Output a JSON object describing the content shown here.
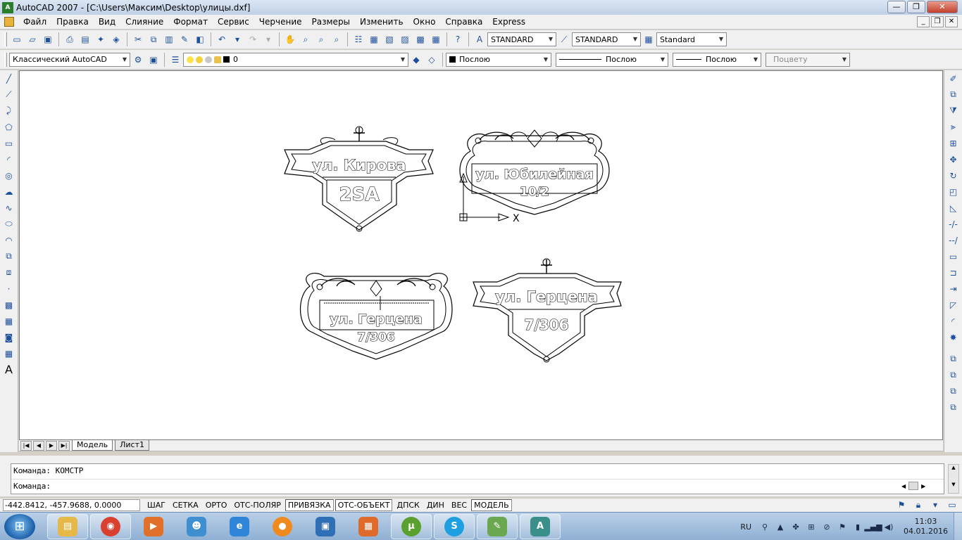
{
  "window": {
    "title": "AutoCAD 2007 - [C:\\Users\\Максим\\Desktop\\улицы.dxf]",
    "app_icon_label": "A",
    "buttons": [
      "—",
      "❐",
      "✕"
    ]
  },
  "menu": {
    "items": [
      "Файл",
      "Правка",
      "Вид",
      "Слияние",
      "Формат",
      "Сервис",
      "Черчение",
      "Размеры",
      "Изменить",
      "Окно",
      "Справка",
      "Express"
    ],
    "mdi_buttons": [
      "_",
      "❐",
      "✕"
    ]
  },
  "toolbar1": {
    "text_style": "STANDARD",
    "dim_style": "STANDARD",
    "table_style": "Standard"
  },
  "toolbar2": {
    "workspace": "Классический AutoCAD",
    "layer": "0",
    "color": "Послою",
    "linetype": "Послою",
    "lineweight": "Послою",
    "plot_style": "Поцвету"
  },
  "signs": [
    {
      "street": "ул. Кирова",
      "number": "2SA"
    },
    {
      "street": "ул. Юбилейная",
      "number": "10/2"
    },
    {
      "street": "ул. Герцена",
      "number": "7/306"
    },
    {
      "street": "ул. Герцена",
      "number": "7/306"
    }
  ],
  "ucs": {
    "x_label": "X"
  },
  "layout_tabs": {
    "nav": [
      "|◀",
      "◀",
      "▶",
      "▶|"
    ],
    "tabs": [
      "Модель",
      "Лист1"
    ],
    "active": "Модель"
  },
  "command": {
    "history": "Команда:  КОМСТР",
    "prompt": "Команда:"
  },
  "status": {
    "coords": "-442.8412, -457.9688, 0.0000",
    "toggles": [
      {
        "label": "ШАГ",
        "on": false
      },
      {
        "label": "СЕТКА",
        "on": false
      },
      {
        "label": "ОРТО",
        "on": false
      },
      {
        "label": "ОТС-ПОЛЯР",
        "on": false
      },
      {
        "label": "ПРИВЯЗКА",
        "on": true
      },
      {
        "label": "ОТС-ОБЪЕКТ",
        "on": true
      },
      {
        "label": "ДПСК",
        "on": false
      },
      {
        "label": "ДИН",
        "on": false
      },
      {
        "label": "ВЕС",
        "on": false
      },
      {
        "label": "МОДЕЛЬ",
        "on": true
      }
    ]
  },
  "taskbar": {
    "lang": "RU",
    "time": "11:03",
    "date": "04.01.2016",
    "apps": [
      {
        "name": "explorer",
        "color": "#e5b84a",
        "glyph": "▤"
      },
      {
        "name": "chrome",
        "color": "#d9402f",
        "glyph": "◉"
      },
      {
        "name": "media-player",
        "color": "#e0702a",
        "glyph": "▶"
      },
      {
        "name": "people",
        "color": "#3e8fd0",
        "glyph": "☻"
      },
      {
        "name": "internet-explorer",
        "color": "#2f86d8",
        "glyph": "e"
      },
      {
        "name": "ball-app",
        "color": "#f08a1e",
        "glyph": "●"
      },
      {
        "name": "store-bag",
        "color": "#2f6fb5",
        "glyph": "▣"
      },
      {
        "name": "box-app",
        "color": "#e06a2a",
        "glyph": "▦"
      },
      {
        "name": "utorrent",
        "color": "#5aa02e",
        "glyph": "µ"
      },
      {
        "name": "skype",
        "color": "#1e9fe0",
        "glyph": "S"
      },
      {
        "name": "green-app",
        "color": "#6aa84f",
        "glyph": "✎"
      },
      {
        "name": "autocad",
        "color": "#3a8f8a",
        "glyph": "A"
      }
    ]
  }
}
